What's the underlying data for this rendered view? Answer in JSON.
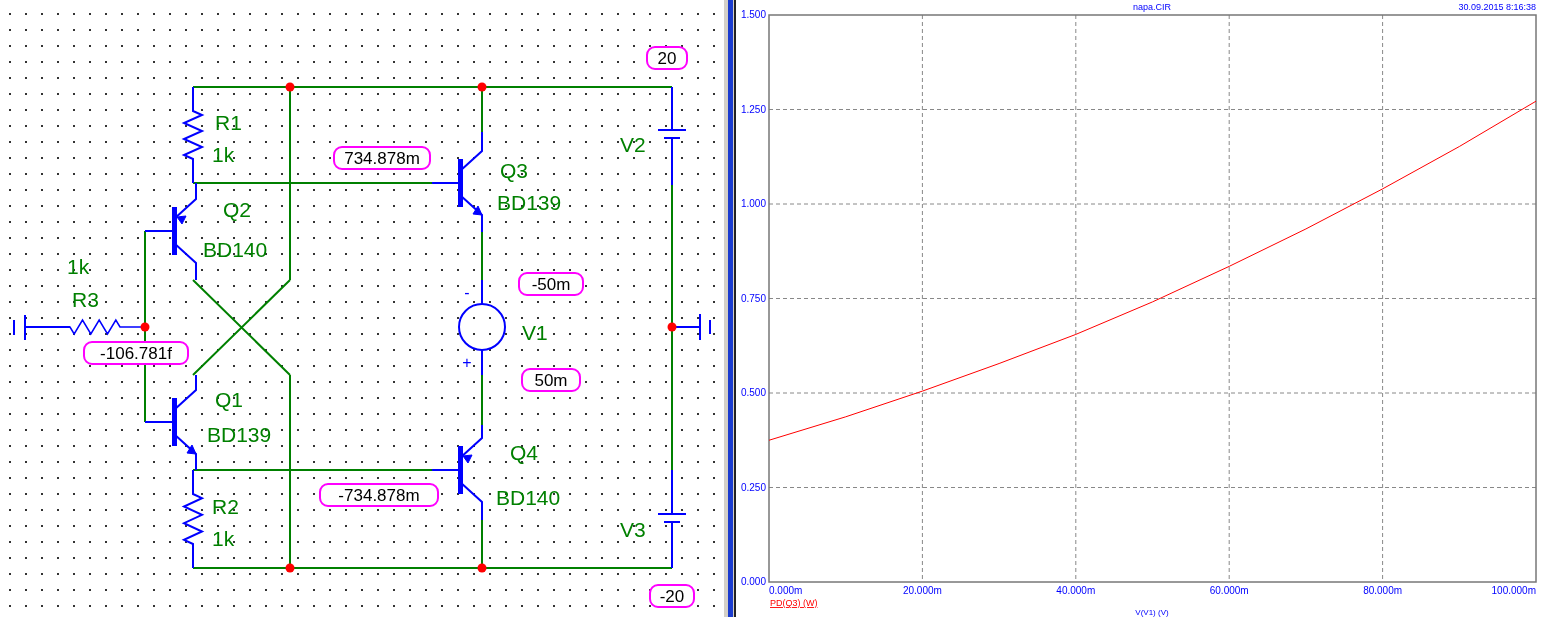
{
  "schematic": {
    "components": [
      {
        "kind": "resistor",
        "name": "R1",
        "value": "1k"
      },
      {
        "kind": "pnp",
        "name": "Q2",
        "value": "BD140"
      },
      {
        "kind": "resistor",
        "name": "R3",
        "value": "1k"
      },
      {
        "kind": "npn",
        "name": "Q1",
        "value": "BD139"
      },
      {
        "kind": "resistor",
        "name": "R2",
        "value": "1k"
      },
      {
        "kind": "npn",
        "name": "Q3",
        "value": "BD139"
      },
      {
        "kind": "battery",
        "name": "V2"
      },
      {
        "kind": "source",
        "name": "V1",
        "polarity": [
          "-",
          "+"
        ]
      },
      {
        "kind": "pnp",
        "name": "Q4",
        "value": "BD140"
      },
      {
        "kind": "battery",
        "name": "V3"
      }
    ],
    "node_labels": [
      "20",
      "734.878m",
      "-50m",
      "-106.781f",
      "50m",
      "-734.878m",
      "-20"
    ]
  },
  "plot": {
    "title": "napa.CIR",
    "timestamp": "30.09.2015 8:16:38",
    "chart_data": {
      "type": "line",
      "xlabel": "V(V1) (V)",
      "x": [
        0,
        10,
        20,
        30,
        40,
        50,
        60,
        70,
        80,
        90,
        100
      ],
      "series": [
        {
          "name": "PD(Q3) (W)",
          "color": "#ff0000",
          "values": [
            0.375,
            0.437,
            0.505,
            0.578,
            0.655,
            0.741,
            0.835,
            0.934,
            1.04,
            1.152,
            1.272
          ]
        }
      ],
      "xlim": [
        0,
        100
      ],
      "ylim": [
        0,
        1.5
      ],
      "grid": true,
      "xticks": [
        {
          "value": 0,
          "label": "0.000m"
        },
        {
          "value": 20,
          "label": "20.000m"
        },
        {
          "value": 40,
          "label": "40.000m"
        },
        {
          "value": 60,
          "label": "60.000m"
        },
        {
          "value": 80,
          "label": "80.000m"
        },
        {
          "value": 100,
          "label": "100.000m"
        }
      ],
      "yticks": [
        {
          "value": 0,
          "label": "0.000"
        },
        {
          "value": 0.25,
          "label": "0.250"
        },
        {
          "value": 0.5,
          "label": "0.500"
        },
        {
          "value": 0.75,
          "label": "0.750"
        },
        {
          "value": 1,
          "label": "1.000"
        },
        {
          "value": 1.25,
          "label": "1.250"
        },
        {
          "value": 1.5,
          "label": "1.500"
        }
      ]
    }
  }
}
